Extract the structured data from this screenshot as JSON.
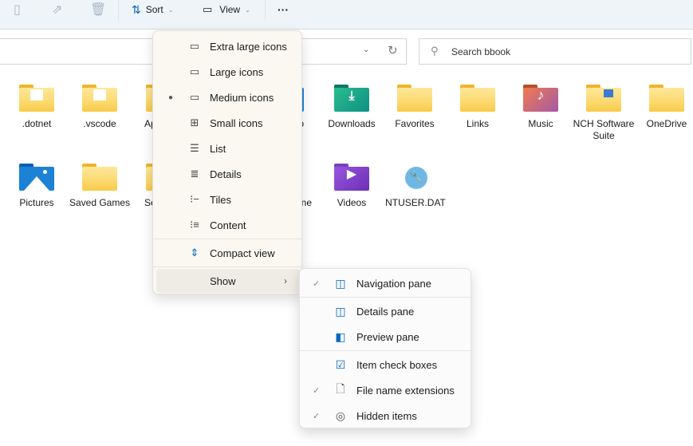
{
  "toolbar": {
    "rename_icon": "rename-icon",
    "share_icon": "share-icon",
    "delete_icon": "delete-icon",
    "sort_label": "Sort",
    "view_label": "View",
    "more_label": "···"
  },
  "address_bar": {
    "value": ""
  },
  "search": {
    "placeholder": "Search bbook"
  },
  "items": [
    {
      "name": ".dotnet",
      "type": "folder"
    },
    {
      "name": ".vscode",
      "type": "folder"
    },
    {
      "name": "Ap",
      "type": "folder"
    },
    {
      "name": "p",
      "type": "folder"
    },
    {
      "name": "Downloads",
      "type": "folder"
    },
    {
      "name": "Favorites",
      "type": "folder"
    },
    {
      "name": "Links",
      "type": "folder"
    },
    {
      "name": "Music",
      "type": "folder"
    },
    {
      "name": "NCH Software Suite",
      "type": "folder"
    },
    {
      "name": "OneDrive",
      "type": "folder"
    },
    {
      "name": "Pictures",
      "type": "folder"
    },
    {
      "name": "Saved Games",
      "type": "folder"
    },
    {
      "name": "Se",
      "type": "folder"
    },
    {
      "name": "ne",
      "type": "folder"
    },
    {
      "name": "Videos",
      "type": "folder"
    },
    {
      "name": "NTUSER.DAT",
      "type": "file"
    }
  ],
  "view_menu": {
    "items": [
      {
        "label": "Extra large icons",
        "icon": "extra-large-icons-icon",
        "selected": false
      },
      {
        "label": "Large icons",
        "icon": "large-icons-icon",
        "selected": false
      },
      {
        "label": "Medium icons",
        "icon": "medium-icons-icon",
        "selected": true
      },
      {
        "label": "Small icons",
        "icon": "small-icons-icon",
        "selected": false
      },
      {
        "label": "List",
        "icon": "list-icon",
        "selected": false
      },
      {
        "label": "Details",
        "icon": "details-icon",
        "selected": false
      },
      {
        "label": "Tiles",
        "icon": "tiles-icon",
        "selected": false
      },
      {
        "label": "Content",
        "icon": "content-icon",
        "selected": false
      }
    ],
    "compact_view": "Compact view",
    "show": "Show"
  },
  "show_submenu": {
    "items": [
      {
        "label": "Navigation pane",
        "checked": true
      },
      {
        "label": "Details pane",
        "checked": false
      },
      {
        "label": "Preview pane",
        "checked": false
      },
      {
        "label": "Item check boxes",
        "checked": false
      },
      {
        "label": "File name extensions",
        "checked": true
      },
      {
        "label": "Hidden items",
        "checked": true
      }
    ]
  },
  "colors": {
    "accent": "#0067c0",
    "toolbar_bg": "#eff4f8",
    "menu_bg": "#faf8f1"
  }
}
